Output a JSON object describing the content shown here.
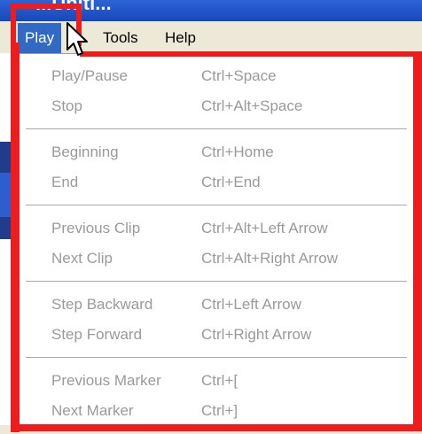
{
  "window": {
    "title": "...Uniti..."
  },
  "menubar": {
    "items": [
      {
        "label": "Play",
        "active": true
      },
      {
        "label": "Tools",
        "active": false
      },
      {
        "label": "Help",
        "active": false
      }
    ]
  },
  "play_menu": {
    "groups": [
      [
        {
          "label": "Play/Pause",
          "shortcut": "Ctrl+Space"
        },
        {
          "label": "Stop",
          "shortcut": "Ctrl+Alt+Space"
        }
      ],
      [
        {
          "label": "Beginning",
          "shortcut": "Ctrl+Home"
        },
        {
          "label": "End",
          "shortcut": "Ctrl+End"
        }
      ],
      [
        {
          "label": "Previous Clip",
          "shortcut": "Ctrl+Alt+Left Arrow"
        },
        {
          "label": "Next Clip",
          "shortcut": "Ctrl+Alt+Right Arrow"
        }
      ],
      [
        {
          "label": "Step Backward",
          "shortcut": "Ctrl+Left Arrow"
        },
        {
          "label": "Step Forward",
          "shortcut": "Ctrl+Right Arrow"
        }
      ],
      [
        {
          "label": "Previous Marker",
          "shortcut": "Ctrl+["
        },
        {
          "label": "Next Marker",
          "shortcut": "Ctrl+]"
        }
      ]
    ]
  },
  "colors": {
    "menu_highlight": "#316ac5",
    "disabled_text": "#9a9a9a",
    "annotation_red": "#ee1c1c"
  },
  "icons": {
    "cursor": "mouse-pointer-icon"
  }
}
